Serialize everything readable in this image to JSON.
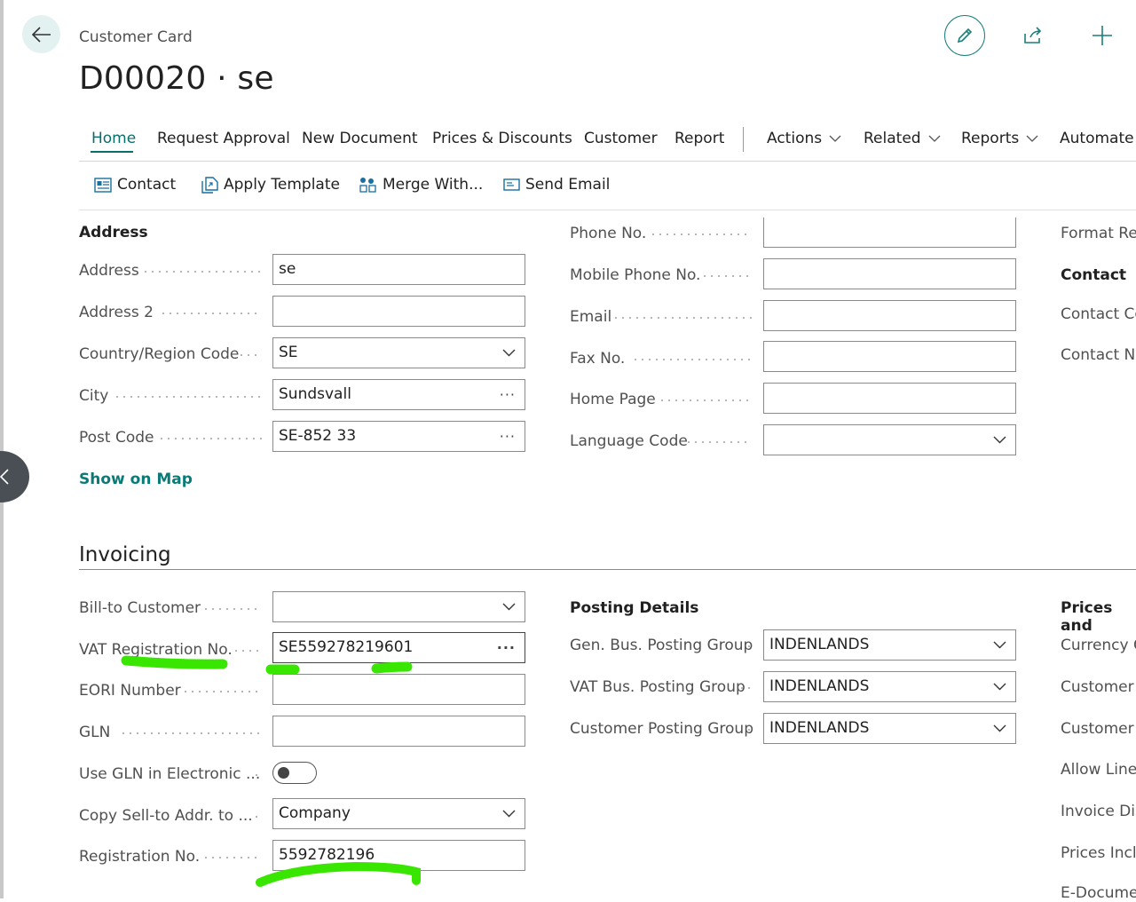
{
  "header": {
    "breadcrumb": "Customer Card",
    "title": "D00020 · se"
  },
  "tabs": [
    {
      "label": "Home"
    },
    {
      "label": "Request Approval"
    },
    {
      "label": "New Document"
    },
    {
      "label": "Prices & Discounts"
    },
    {
      "label": "Customer"
    },
    {
      "label": "Report"
    },
    {
      "label": "Actions"
    },
    {
      "label": "Related"
    },
    {
      "label": "Reports"
    },
    {
      "label": "Automate"
    }
  ],
  "subactions": [
    {
      "label": "Contact"
    },
    {
      "label": "Apply Template"
    },
    {
      "label": "Merge With..."
    },
    {
      "label": "Send Email"
    }
  ],
  "address": {
    "section": "Address",
    "address_label": "Address",
    "address_value": "se",
    "address2_label": "Address 2",
    "address2_value": "",
    "country_label": "Country/Region Code",
    "country_value": "SE",
    "city_label": "City",
    "city_value": "Sundsvall",
    "postcode_label": "Post Code",
    "postcode_value": "SE-852 33",
    "show_on_map": "Show on Map"
  },
  "contact_info": {
    "phone_label": "Phone No.",
    "mobile_label": "Mobile Phone No.",
    "email_label": "Email",
    "fax_label": "Fax No.",
    "homepage_label": "Home Page",
    "language_label": "Language Code"
  },
  "right_col": {
    "format_region": "Format Reg",
    "contact_section": "Contact",
    "contact_code": "Contact Co",
    "contact_name": "Contact Na"
  },
  "invoicing": {
    "section": "Invoicing",
    "billto_label": "Bill-to Customer",
    "billto_value": "",
    "vat_label": "VAT Registration No.",
    "vat_value": "SE559278219601",
    "eori_label": "EORI Number",
    "eori_value": "",
    "gln_label": "GLN",
    "gln_value": "",
    "use_gln_label": "Use GLN in Electronic ...",
    "copy_label": "Copy Sell-to Addr. to ...",
    "copy_value": "Company",
    "regno_label": "Registration No.",
    "regno_value": "5592782196"
  },
  "posting": {
    "section": "Posting Details",
    "gen_bus_label": "Gen. Bus. Posting Group",
    "gen_bus_value": "INDENLANDS",
    "vat_bus_label": "VAT Bus. Posting Group",
    "vat_bus_value": "INDENLANDS",
    "cust_posting_label": "Customer Posting Group",
    "cust_posting_value": "INDENLANDS"
  },
  "prices": {
    "section": "Prices and",
    "currency": "Currency C",
    "customer_p": "Customer P",
    "customer_d": "Customer D",
    "allow_line": "Allow Line",
    "invoice_disc": "Invoice Disc",
    "prices_incl": "Prices Inclu",
    "e_document": "E-Documen"
  },
  "colors": {
    "accent": "#0a6e6b",
    "highlight": "#39e600"
  }
}
